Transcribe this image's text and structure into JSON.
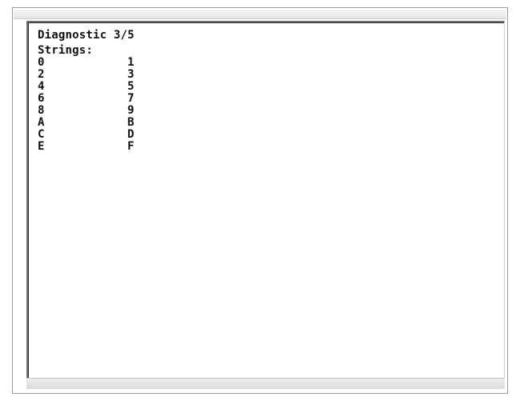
{
  "screen": {
    "title": "Diagnostic 3/5",
    "section_label": "Strings:",
    "rows": [
      {
        "left": "0",
        "right": "1"
      },
      {
        "left": "2",
        "right": "3"
      },
      {
        "left": "4",
        "right": "5"
      },
      {
        "left": "6",
        "right": "7"
      },
      {
        "left": "8",
        "right": "9"
      },
      {
        "left": "A",
        "right": "B"
      },
      {
        "left": "C",
        "right": "D"
      },
      {
        "left": "E",
        "right": "F"
      }
    ]
  }
}
